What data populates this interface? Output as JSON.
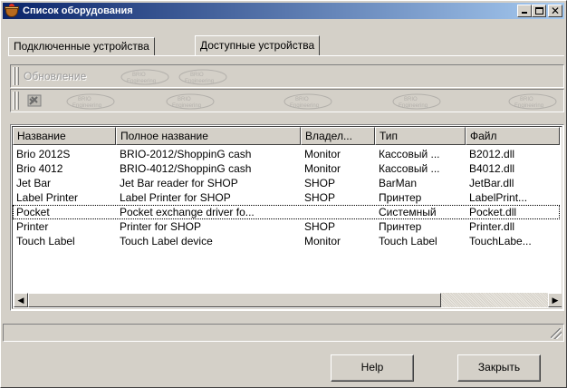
{
  "window": {
    "title": "Список оборудования",
    "icon": "app-bowl-icon",
    "controls": [
      "minimize-icon",
      "maximize-icon",
      "close-icon"
    ],
    "close_glyph": "✕"
  },
  "tabs": [
    {
      "label": "Подключенные устройства",
      "active": false
    },
    {
      "label": "Доступные устройства",
      "active": true
    }
  ],
  "toolbar": {
    "refresh_label": "Обновление",
    "tool_icon": "tools-icon"
  },
  "watermark_text": "BRIO Engineering",
  "table": {
    "columns": [
      "Название",
      "Полное название",
      "Владел...",
      "Тип",
      "Файл"
    ],
    "rows": [
      [
        "Brio 2012S",
        "BRIO-2012/ShoppinG cash",
        "Monitor",
        "Кассовый ...",
        "B2012.dll"
      ],
      [
        "Brio 4012",
        "BRIO-4012/ShoppinG cash",
        "Monitor",
        "Кассовый ...",
        "B4012.dll"
      ],
      [
        "Jet Bar",
        "Jet Bar reader for SHOP",
        "SHOP",
        "BarMan",
        "JetBar.dll"
      ],
      [
        "Label Printer",
        "Label Printer for SHOP",
        "SHOP",
        "Принтер",
        "LabelPrint..."
      ],
      [
        "Pocket",
        "Pocket exchange driver fo...",
        "",
        "Системный",
        "Pocket.dll"
      ],
      [
        "Printer",
        "Printer for SHOP",
        "SHOP",
        "Принтер",
        "Printer.dll"
      ],
      [
        "Touch Label",
        "Touch Label device",
        "Monitor",
        "Touch Label",
        "TouchLabe..."
      ]
    ],
    "focused_row": 4
  },
  "scrollbar": {
    "left_arrow": "◀",
    "right_arrow": "▶"
  },
  "buttons": {
    "help_label": "Help",
    "close_label": "Закрыть"
  }
}
